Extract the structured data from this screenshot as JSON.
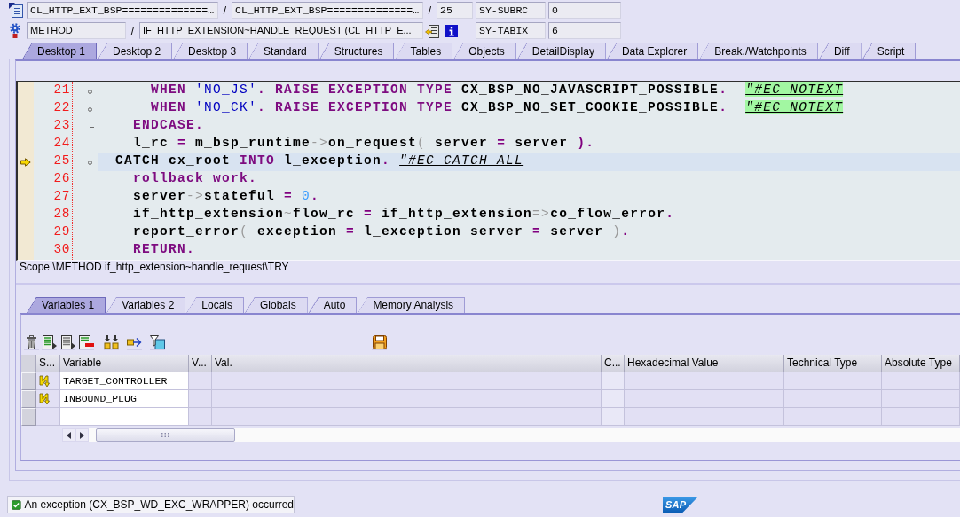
{
  "header_rows": [
    {
      "items": [
        {
          "kind": "field",
          "text": "CL_HTTP_EXT_BSP==============…"
        },
        {
          "kind": "separator",
          "text": "/"
        },
        {
          "kind": "field",
          "text": "CL_HTTP_EXT_BSP==============…"
        },
        {
          "kind": "separator",
          "text": "/"
        },
        {
          "kind": "field",
          "text": "25"
        }
      ],
      "system_field": {
        "name": "SY-SUBRC",
        "value": "0"
      }
    },
    {
      "items": [
        {
          "kind": "field",
          "text": "METHOD"
        },
        {
          "kind": "separator",
          "text": "/"
        },
        {
          "kind": "field",
          "text": "IF_HTTP_EXTENSION~HANDLE_REQUEST (CL_HTTP_E..."
        }
      ],
      "system_field": {
        "name": "SY-TABIX",
        "value": "6"
      }
    }
  ],
  "desktop_tabs": [
    {
      "label": "Desktop 1",
      "selected": true
    },
    {
      "label": "Desktop 2",
      "selected": false
    },
    {
      "label": "Desktop 3",
      "selected": false
    },
    {
      "label": "Standard",
      "selected": false
    },
    {
      "label": "Structures",
      "selected": false
    },
    {
      "label": "Tables",
      "selected": false
    },
    {
      "label": "Objects",
      "selected": false
    },
    {
      "label": "DetailDisplay",
      "selected": false
    },
    {
      "label": "Data Explorer",
      "selected": false
    },
    {
      "label": "Break./Watchpoints",
      "selected": false
    },
    {
      "label": "Diff",
      "selected": false
    },
    {
      "label": "Script",
      "selected": false
    }
  ],
  "editor": {
    "lines": [
      {
        "number": "21",
        "current": false,
        "fold_node": true,
        "fold_end": false,
        "tokens": [
          {
            "kind": "keyword",
            "text": "      WHEN"
          },
          {
            "kind": "string",
            "text": " 'NO_JS'"
          },
          {
            "kind": "operator",
            "text": "."
          },
          {
            "kind": "keyword",
            "text": " RAISE EXCEPTION TYPE"
          },
          {
            "kind": "name",
            "text": " CX_BSP_NO_JAVASCRIPT_POSSIBLE"
          },
          {
            "kind": "operator",
            "text": ".  "
          },
          {
            "kind": "pragma",
            "text": "\"#EC NOTEXT"
          }
        ]
      },
      {
        "number": "22",
        "current": false,
        "fold_node": true,
        "fold_end": false,
        "tokens": [
          {
            "kind": "keyword",
            "text": "      WHEN"
          },
          {
            "kind": "string",
            "text": " 'NO_CK'"
          },
          {
            "kind": "operator",
            "text": "."
          },
          {
            "kind": "keyword",
            "text": " RAISE EXCEPTION TYPE"
          },
          {
            "kind": "name",
            "text": " CX_BSP_NO_SET_COOKIE_POSSIBLE"
          },
          {
            "kind": "operator",
            "text": ".  "
          },
          {
            "kind": "pragma",
            "text": "\"#EC NOTEXT"
          }
        ]
      },
      {
        "number": "23",
        "current": false,
        "fold_node": false,
        "fold_end": true,
        "tokens": [
          {
            "kind": "keyword",
            "text": "    ENDCASE"
          },
          {
            "kind": "operator",
            "text": "."
          }
        ]
      },
      {
        "number": "24",
        "current": false,
        "fold_node": false,
        "fold_end": false,
        "tokens": [
          {
            "kind": "name",
            "text": "    l_rc "
          },
          {
            "kind": "operator",
            "text": "="
          },
          {
            "kind": "name",
            "text": " m_bsp_runtime"
          },
          {
            "kind": "symbol",
            "text": "->"
          },
          {
            "kind": "name",
            "text": "on_request"
          },
          {
            "kind": "symbol",
            "text": "("
          },
          {
            "kind": "name",
            "text": " server "
          },
          {
            "kind": "operator",
            "text": "="
          },
          {
            "kind": "name",
            "text": " server "
          },
          {
            "kind": "operator",
            "text": ")."
          }
        ]
      },
      {
        "number": "25",
        "current": true,
        "fold_node": true,
        "fold_end": false,
        "tokens": [
          {
            "kind": "name",
            "text": "  CATCH cx_root "
          },
          {
            "kind": "keyword",
            "text": "INTO"
          },
          {
            "kind": "name",
            "text": " l_exception"
          },
          {
            "kind": "operator",
            "text": ". "
          },
          {
            "kind": "comment",
            "text": "\"#EC CATCH ALL"
          }
        ]
      },
      {
        "number": "26",
        "current": false,
        "fold_node": false,
        "fold_end": false,
        "tokens": [
          {
            "kind": "keyword",
            "text": "    rollback work"
          },
          {
            "kind": "operator",
            "text": "."
          }
        ]
      },
      {
        "number": "27",
        "current": false,
        "fold_node": false,
        "fold_end": false,
        "tokens": [
          {
            "kind": "name",
            "text": "    server"
          },
          {
            "kind": "symbol",
            "text": "->"
          },
          {
            "kind": "name",
            "text": "stateful "
          },
          {
            "kind": "operator",
            "text": "= "
          },
          {
            "kind": "number",
            "text": "0"
          },
          {
            "kind": "operator",
            "text": "."
          }
        ]
      },
      {
        "number": "28",
        "current": false,
        "fold_node": false,
        "fold_end": false,
        "tokens": [
          {
            "kind": "name",
            "text": "    if_http_extension"
          },
          {
            "kind": "symbol",
            "text": "~"
          },
          {
            "kind": "name",
            "text": "flow_rc "
          },
          {
            "kind": "operator",
            "text": "="
          },
          {
            "kind": "name",
            "text": " if_http_extension"
          },
          {
            "kind": "symbol",
            "text": "=>"
          },
          {
            "kind": "name",
            "text": "co_flow_error"
          },
          {
            "kind": "operator",
            "text": "."
          }
        ]
      },
      {
        "number": "29",
        "current": false,
        "fold_node": false,
        "fold_end": false,
        "tokens": [
          {
            "kind": "name",
            "text": "    report_error"
          },
          {
            "kind": "symbol",
            "text": "("
          },
          {
            "kind": "name",
            "text": " exception "
          },
          {
            "kind": "operator",
            "text": "="
          },
          {
            "kind": "name",
            "text": " l_exception server "
          },
          {
            "kind": "operator",
            "text": "="
          },
          {
            "kind": "name",
            "text": " server "
          },
          {
            "kind": "symbol",
            "text": ")"
          },
          {
            "kind": "operator",
            "text": "."
          }
        ]
      },
      {
        "number": "30",
        "current": false,
        "fold_node": false,
        "fold_end": false,
        "tokens": [
          {
            "kind": "keyword",
            "text": "    RETURN"
          },
          {
            "kind": "operator",
            "text": "."
          }
        ]
      }
    ],
    "scope": "Scope \\METHOD if_http_extension~handle_request\\TRY"
  },
  "variable_tabs": [
    {
      "label": "Variables 1",
      "selected": true
    },
    {
      "label": "Variables 2",
      "selected": false
    },
    {
      "label": "Locals",
      "selected": false
    },
    {
      "label": "Globals",
      "selected": false
    },
    {
      "label": "Auto",
      "selected": false
    },
    {
      "label": "Memory Analysis",
      "selected": false
    }
  ],
  "variables_table": {
    "columns": [
      "S...",
      "Variable",
      "V...",
      "Val.",
      "C...",
      "Hexadecimal Value",
      "Technical Type",
      "Absolute Type"
    ],
    "rows": [
      {
        "variable": "TARGET_CONTROLLER"
      },
      {
        "variable": "INBOUND_PLUG"
      }
    ]
  },
  "status_bar": {
    "kind": "success",
    "message": "An exception (CX_BSP_WD_EXC_WRAPPER) occurred"
  },
  "logo": "SAP"
}
